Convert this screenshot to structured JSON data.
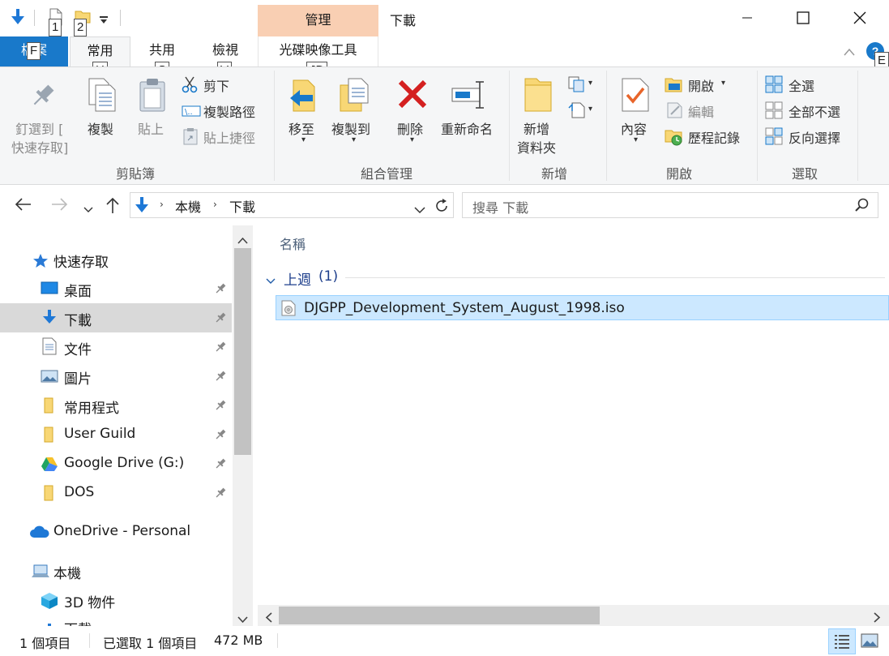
{
  "titlebar": {
    "quick_access_keytips": [
      "1",
      "2"
    ],
    "context_tab_header": "管理",
    "window_title": "下載"
  },
  "tabs": {
    "file": "檔案",
    "file_keytip": "F",
    "home": "常用",
    "home_keytip": "H",
    "share": "共用",
    "share_keytip": "S",
    "view": "檢視",
    "view_keytip": "V",
    "disc": "光碟映像工具",
    "disc_keytip": "JD",
    "help_keytip": "E"
  },
  "ribbon": {
    "clipboard": {
      "group_label": "剪貼簿",
      "pin_line1": "釘選到 [",
      "pin_line2": "快速存取]",
      "copy": "複製",
      "paste": "貼上",
      "cut": "剪下",
      "copy_path": "複製路徑",
      "paste_shortcut": "貼上捷徑"
    },
    "organize": {
      "group_label": "組合管理",
      "move_to": "移至",
      "copy_to": "複製到",
      "delete": "刪除",
      "rename": "重新命名"
    },
    "new": {
      "group_label": "新增",
      "new_folder_line1": "新增",
      "new_folder_line2": "資料夾"
    },
    "open": {
      "group_label": "開啟",
      "properties": "內容",
      "open": "開啟",
      "edit": "編輯",
      "history": "歷程記錄"
    },
    "select": {
      "group_label": "選取",
      "select_all": "全選",
      "select_none": "全部不選",
      "invert": "反向選擇"
    }
  },
  "address": {
    "crumbs": [
      "本機",
      "下載"
    ],
    "search_placeholder": "搜尋 下載"
  },
  "nav": {
    "quick_access": "快速存取",
    "items": [
      {
        "label": "桌面",
        "pinned": true
      },
      {
        "label": "下載",
        "pinned": true
      },
      {
        "label": "文件",
        "pinned": true
      },
      {
        "label": "圖片",
        "pinned": true
      },
      {
        "label": "常用程式",
        "pinned": true
      },
      {
        "label": "User Guild",
        "pinned": true
      },
      {
        "label": "Google Drive (G:)",
        "pinned": true
      },
      {
        "label": "DOS",
        "pinned": true
      }
    ],
    "onedrive": "OneDrive - Personal",
    "this_pc": "本機",
    "objects_3d": "3D 物件",
    "downloads_partial": "下載"
  },
  "filelist": {
    "column_name": "名稱",
    "group_label": "上週",
    "group_count": "(1)",
    "files": [
      {
        "name": "DJGPP_Development_System_August_1998.iso",
        "selected": true
      }
    ]
  },
  "status": {
    "item_count": "1 個項目",
    "selected": "已選取 1 個項目",
    "size": "472 MB"
  },
  "colors": {
    "accent": "#1979ca",
    "context_tab": "#f9cfb3",
    "selection": "#cce8ff",
    "selection_border": "#99d1ff",
    "nav_selected": "#d9d9d9"
  }
}
